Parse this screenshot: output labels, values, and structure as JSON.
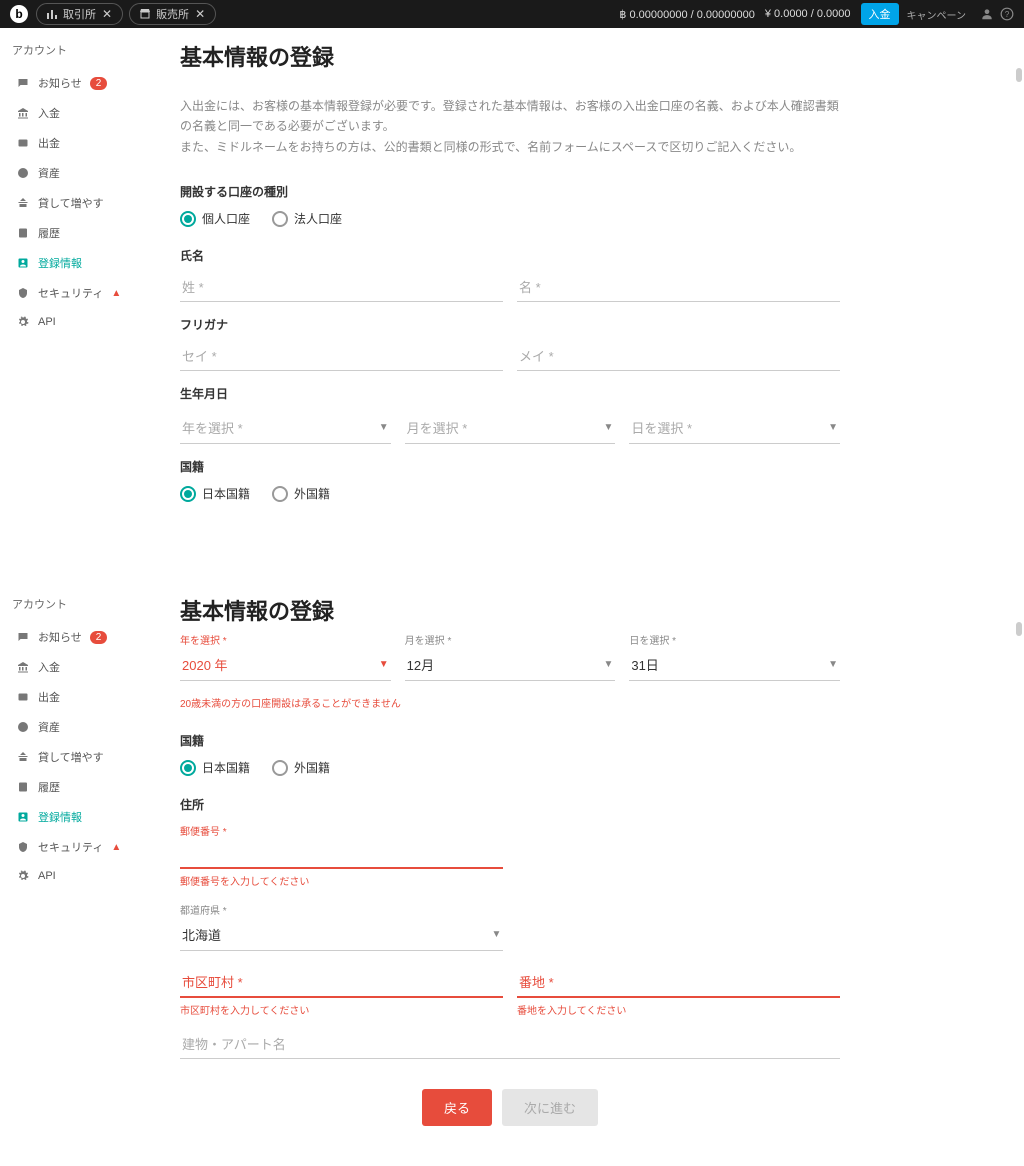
{
  "topbar": {
    "nav1": "取引所",
    "nav2": "販売所",
    "btc_balance": "฿  0.00000000 / 0.00000000",
    "jpy_balance": "¥  0.0000 / 0.0000",
    "deposit": "入金",
    "campaign": "キャンペーン"
  },
  "sidebar": {
    "title": "アカウント",
    "items": [
      {
        "label": "お知らせ",
        "badge": "2"
      },
      {
        "label": "入金"
      },
      {
        "label": "出金"
      },
      {
        "label": "資産"
      },
      {
        "label": "貸して増やす"
      },
      {
        "label": "履歴"
      },
      {
        "label": "登録情報",
        "active": true
      },
      {
        "label": "セキュリティ",
        "warn": true
      },
      {
        "label": "API"
      }
    ]
  },
  "page1": {
    "title": "基本情報の登録",
    "intro1": "入出金には、お客様の基本情報登録が必要です。登録された基本情報は、お客様の入出金口座の名義、および本人確認書類の名義と同一である必要がございます。",
    "intro2": "また、ミドルネームをお持ちの方は、公的書類と同様の形式で、名前フォームにスペースで区切りご記入ください。",
    "account_type": {
      "label": "開設する口座の種別",
      "opt1": "個人口座",
      "opt2": "法人口座"
    },
    "name": {
      "label": "氏名",
      "sei": "姓 *",
      "mei": "名 *"
    },
    "kana": {
      "label": "フリガナ",
      "sei": "セイ *",
      "mei": "メイ *"
    },
    "dob": {
      "label": "生年月日",
      "year": "年を選択 *",
      "month": "月を選択 *",
      "day": "日を選択 *"
    },
    "nationality": {
      "label": "国籍",
      "opt1": "日本国籍",
      "opt2": "外国籍"
    }
  },
  "page2": {
    "title": "基本情報の登録",
    "dob": {
      "year_lbl": "年を選択 *",
      "year_val": "2020 年",
      "month_lbl": "月を選択 *",
      "month_val": "12月",
      "day_lbl": "日を選択 *",
      "day_val": "31日",
      "err": "20歳未満の方の口座開設は承ることができません"
    },
    "nationality": {
      "label": "国籍",
      "opt1": "日本国籍",
      "opt2": "外国籍"
    },
    "address": {
      "label": "住所",
      "postal_lbl": "郵便番号 *",
      "postal_err": "郵便番号を入力してください",
      "pref_lbl": "都道府県 *",
      "pref_val": "北海道",
      "city_ph": "市区町村 *",
      "city_err": "市区町村を入力してください",
      "banchi_ph": "番地 *",
      "banchi_err": "番地を入力してください",
      "building_ph": "建物・アパート名"
    },
    "buttons": {
      "back": "戻る",
      "next": "次に進む"
    }
  }
}
